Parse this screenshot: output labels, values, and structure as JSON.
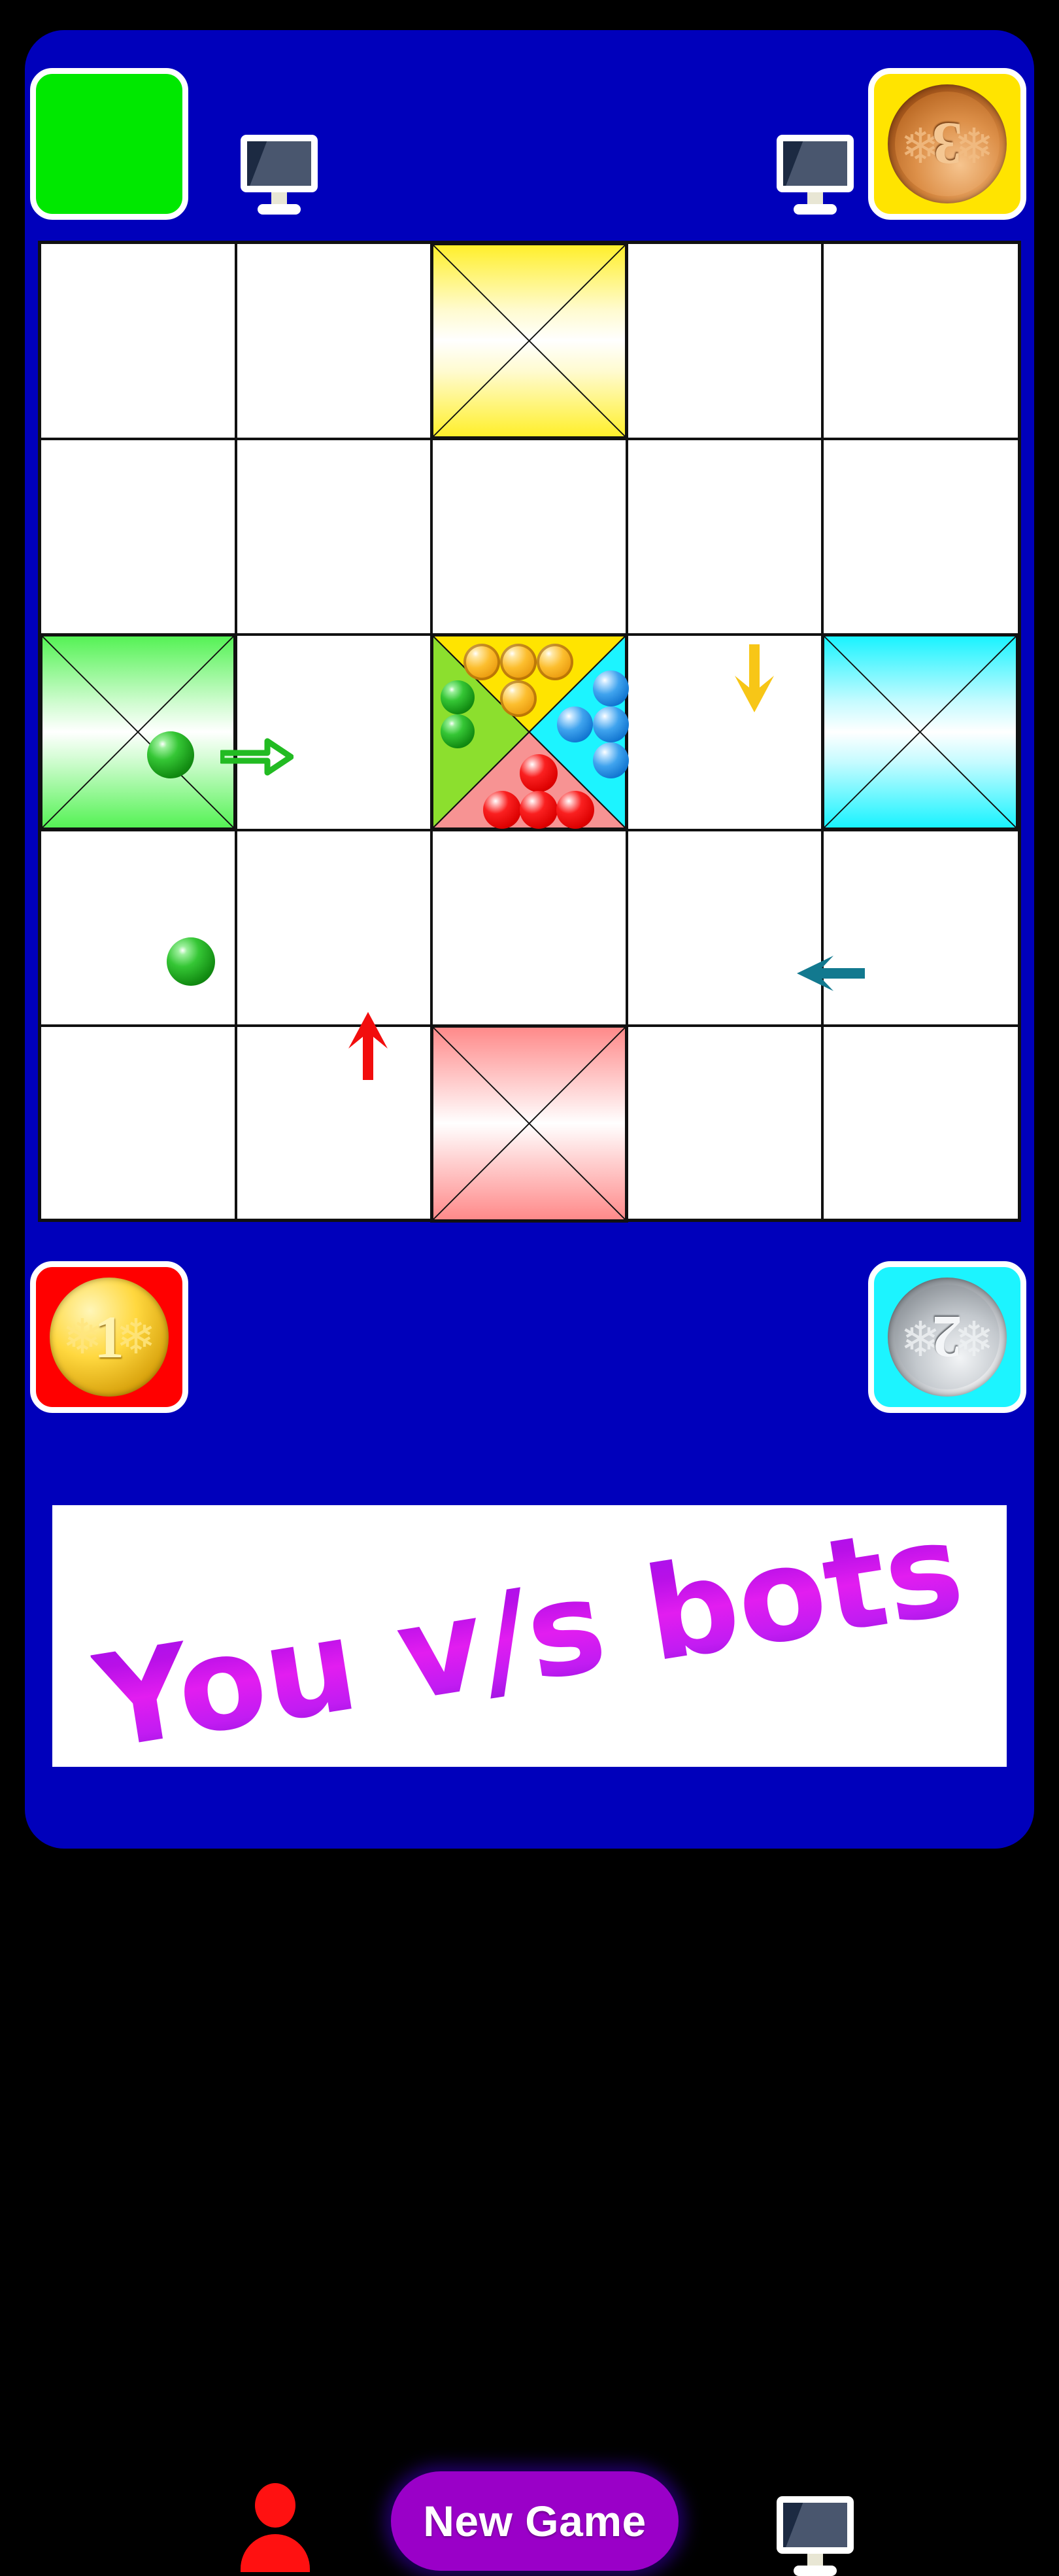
{
  "app": {
    "background_color": "#000000",
    "frame_color": "#0000bb",
    "board_background": "#ffffff",
    "grid_line_color": "#111111"
  },
  "top_bar": {
    "left_badge": {
      "name": "green-player-badge",
      "box_color": "#00e800",
      "content": "",
      "label": ""
    },
    "left_monitor": {
      "name": "bot-monitor-icon",
      "label": ""
    },
    "right_monitor": {
      "name": "bot-monitor-icon",
      "label": ""
    },
    "right_badge": {
      "name": "bronze-medal-badge",
      "box_color": "#ffe400",
      "medal_type": "bronze",
      "rank": "3"
    }
  },
  "board": {
    "rows": 5,
    "columns": 5,
    "home_cells": [
      {
        "name": "yellow-home-cell",
        "color": "#ffef2b",
        "row": 0,
        "col": 2,
        "player": "yellow"
      },
      {
        "name": "green-home-cell",
        "color": "#55f255",
        "row": 2,
        "col": 0,
        "player": "green"
      },
      {
        "name": "cyan-home-cell",
        "color": "#19f3ff",
        "row": 2,
        "col": 4,
        "player": "cyan"
      },
      {
        "name": "red-home-cell",
        "color": "#ff8a8a",
        "row": 4,
        "col": 2,
        "player": "red"
      }
    ],
    "center_cell": {
      "name": "center-home-cell",
      "row": 2,
      "col": 2,
      "quadrants": [
        {
          "side": "top",
          "player": "yellow",
          "color": "#ffe400",
          "tokens": 4,
          "token_color": "#fcbe2e"
        },
        {
          "side": "right",
          "player": "cyan",
          "color": "#1cf4ff",
          "tokens": 4,
          "token_color": "#3fa3ee"
        },
        {
          "side": "bottom",
          "player": "red",
          "color": "#f79393",
          "tokens": 4,
          "token_color": "#fa2020"
        },
        {
          "side": "left",
          "player": "green",
          "color": "#8cdf2e",
          "tokens": 2,
          "token_color": "#35c635"
        }
      ]
    },
    "tokens_on_track": [
      {
        "name": "green-token",
        "color": "#35c635",
        "row": 1,
        "col": 0,
        "player": "green"
      },
      {
        "name": "green-token",
        "color": "#35c635",
        "row": 3,
        "col": 0,
        "player": "green"
      }
    ],
    "direction_arrows": [
      {
        "name": "green-right-arrow",
        "player": "green",
        "direction": "right",
        "color": "#22bb22",
        "style": "outline"
      },
      {
        "name": "yellow-down-arrow",
        "player": "yellow",
        "direction": "down",
        "color": "#f7c617",
        "style": "solid"
      },
      {
        "name": "cyan-left-arrow",
        "player": "cyan",
        "direction": "left",
        "color": "#12798f",
        "style": "solid"
      },
      {
        "name": "red-up-arrow",
        "player": "red",
        "direction": "up",
        "color": "#f20d0d",
        "style": "solid"
      }
    ]
  },
  "bottom_bar": {
    "left_badge": {
      "name": "gold-medal-badge",
      "box_color": "#ff0000",
      "medal_type": "gold",
      "rank": "1"
    },
    "player_icon": {
      "name": "player-person-icon",
      "color": "#ff1111"
    },
    "new_game_button": {
      "name": "new-game-button",
      "label": "New Game",
      "background": "#9a00c8",
      "text_color": "#ffffff"
    },
    "right_monitor": {
      "name": "bot-monitor-icon",
      "label": ""
    },
    "right_badge": {
      "name": "silver-medal-badge",
      "box_color": "#1cf4ff",
      "medal_type": "silver",
      "rank": "2"
    }
  },
  "footer": {
    "banner_text": "You v/s bots",
    "banner_background": "#ffffff",
    "text_gradient_from": "#a512ef",
    "text_gradient_to": "#e21df0",
    "rotation_degrees": "-9"
  }
}
